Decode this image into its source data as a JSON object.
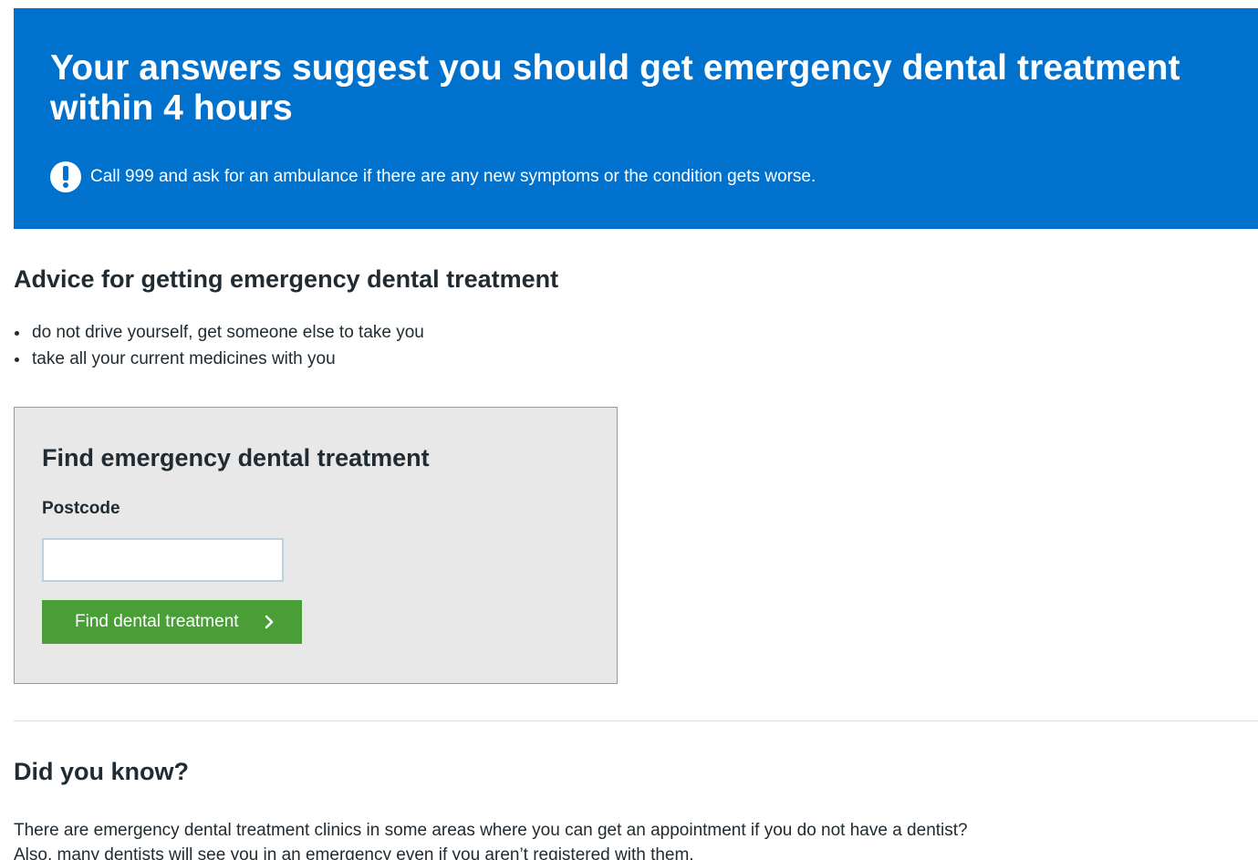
{
  "banner": {
    "title": "Your answers suggest you should get emergency dental treatment within 4 hours",
    "alert_icon": "exclamation-circle-icon",
    "alert_text": "Call 999 and ask for an ambulance if there are any new symptoms or the condition gets worse."
  },
  "advice": {
    "heading": "Advice for getting emergency dental treatment",
    "items": [
      "do not drive yourself, get someone else to take you",
      "take all your current medicines with you"
    ]
  },
  "find": {
    "heading": "Find emergency dental treatment",
    "postcode_label": "Postcode",
    "postcode_value": "",
    "button_label": "Find dental treatment",
    "button_icon": "chevron-right-icon"
  },
  "did_you_know": {
    "heading": "Did you know?",
    "line1": "There are emergency dental treatment clinics in some areas where you can get an appointment if you do not have a dentist?",
    "line2": "Also, many dentists will see you in an emergency even if you aren’t registered with them."
  },
  "colors": {
    "banner_background": "#0072ce",
    "button_background": "#4a9e38",
    "panel_background": "#e8e8e8"
  }
}
